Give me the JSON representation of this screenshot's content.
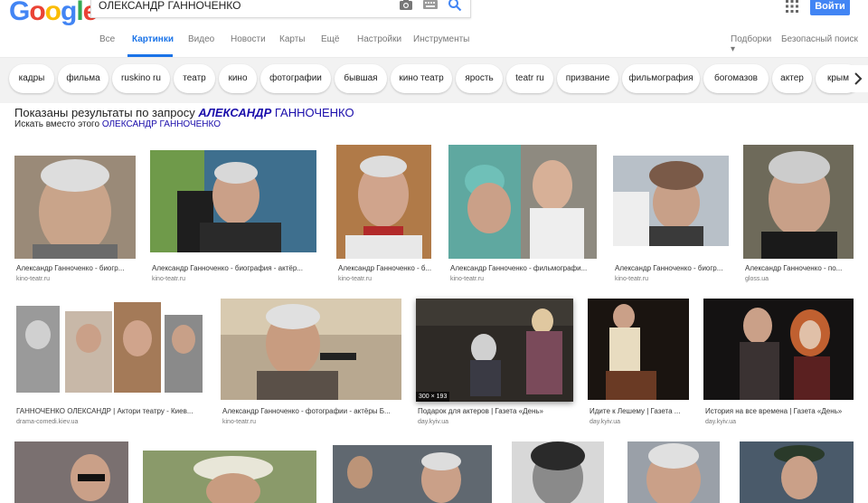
{
  "logo": {
    "letters": [
      "G",
      "o",
      "o",
      "g",
      "l",
      "e"
    ],
    "colors": [
      "#4285f4",
      "#ea4335",
      "#fbbc05",
      "#4285f4",
      "#34a853",
      "#ea4335"
    ]
  },
  "search": {
    "value": "ОЛЕКСАНДР ГАННОЧЕНКО",
    "camera_icon": "camera-icon",
    "keyboard_icon": "keyboard-icon",
    "search_icon": "magnifier-icon"
  },
  "header": {
    "signin": "Войти",
    "apps_icon": "grid-icon",
    "accent": "#4285f4"
  },
  "tabs": [
    {
      "label": "Все",
      "active": false
    },
    {
      "label": "Картинки",
      "active": true
    },
    {
      "label": "Видео",
      "active": false
    },
    {
      "label": "Новости",
      "active": false
    },
    {
      "label": "Карты",
      "active": false
    },
    {
      "label": "Ещё",
      "active": false
    },
    {
      "label": "Настройки",
      "active": false
    },
    {
      "label": "Инструменты",
      "active": false
    }
  ],
  "rightlinks": {
    "collections": "Подборки",
    "safesearch": "Безопасный поиск ▾"
  },
  "chips": [
    "кадры",
    "фильма",
    "ruskino ru",
    "театр",
    "кино",
    "фотографии",
    "бывшая",
    "кино театр",
    "ярость",
    "teatr ru",
    "призвание",
    "фильмография",
    "богомазов",
    "актер",
    "крым"
  ],
  "notice": {
    "prefix": "Показаны результаты по запросу",
    "query_italic": "АЛЕКСАНДР",
    "query_rest": "ГАННОЧЕНКО",
    "instead_prefix": "Искать вместо этого",
    "instead_link": "ОЛЕКСАНДР ГАННОЧЕНКО"
  },
  "results_row1": [
    {
      "caption": "Александр Ганноченко - биогр...",
      "source": "kino-teatr.ru"
    },
    {
      "caption": "Александр Ганноченко - биография - актёр...",
      "source": "kino-teatr.ru"
    },
    {
      "caption": "Александр Ганноченко - б...",
      "source": "kino-teatr.ru"
    },
    {
      "caption": "Александр Ганноченко - фильмографи...",
      "source": "kino-teatr.ru"
    },
    {
      "caption": "Александр Ганноченко - биогр...",
      "source": "kino-teatr.ru"
    },
    {
      "caption": "Александр Ганноченко - по...",
      "source": "gloss.ua"
    }
  ],
  "results_row2": [
    {
      "caption": "ГАННОЧЕНКО ОЛЕКСАНДР | Актори театру - Киев...",
      "source": "drama-comedi.kiev.ua"
    },
    {
      "caption": "Александр Ганноченко - фотографии - актёры Б...",
      "source": "kino-teatr.ru"
    },
    {
      "caption": "Подарок для актеров | Газета «День»",
      "source": "day.kyiv.ua",
      "dims": "300 × 193"
    },
    {
      "caption": "Идите к Лешему | Газета ...",
      "source": "day.kyiv.ua"
    },
    {
      "caption": "История на все времена | Газета «День»",
      "source": "day.kyiv.ua"
    }
  ]
}
